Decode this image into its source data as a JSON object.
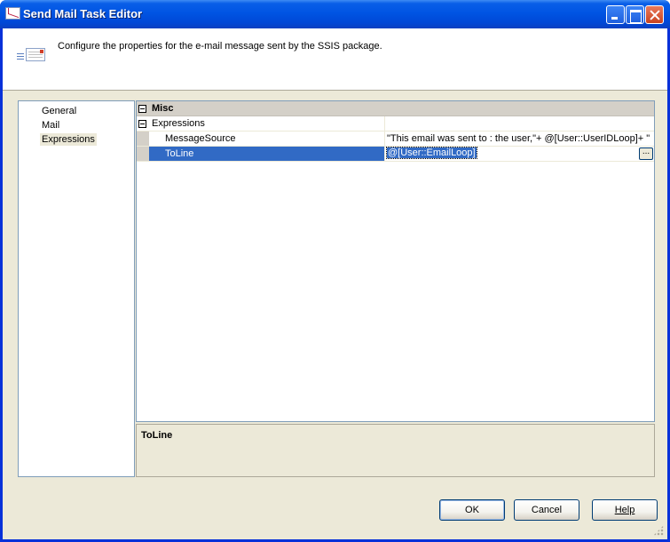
{
  "window": {
    "title": "Send Mail Task Editor"
  },
  "header": {
    "description": "Configure the properties for the e-mail message sent by the SSIS package.",
    "icon": "mail-envelope-icon"
  },
  "nav": {
    "items": [
      {
        "label": "General",
        "selected": false
      },
      {
        "label": "Mail",
        "selected": false
      },
      {
        "label": "Expressions",
        "selected": true
      }
    ]
  },
  "grid": {
    "category": "Misc",
    "group": "Expressions",
    "rows": [
      {
        "name": "MessageSource",
        "value": "\"This email was sent to :  the user,\"+  @[User::UserIDLoop]+ \""
      },
      {
        "name": "ToLine",
        "value": "@[User::EmailLoop]",
        "selected": true
      }
    ],
    "ellipsis_label": "..."
  },
  "description": {
    "title": "ToLine"
  },
  "buttons": {
    "ok": "OK",
    "cancel": "Cancel",
    "help": "Help"
  },
  "colors": {
    "titlebar": "#0054e3",
    "selection": "#316ac5",
    "dialog_bg": "#ece9d8"
  }
}
